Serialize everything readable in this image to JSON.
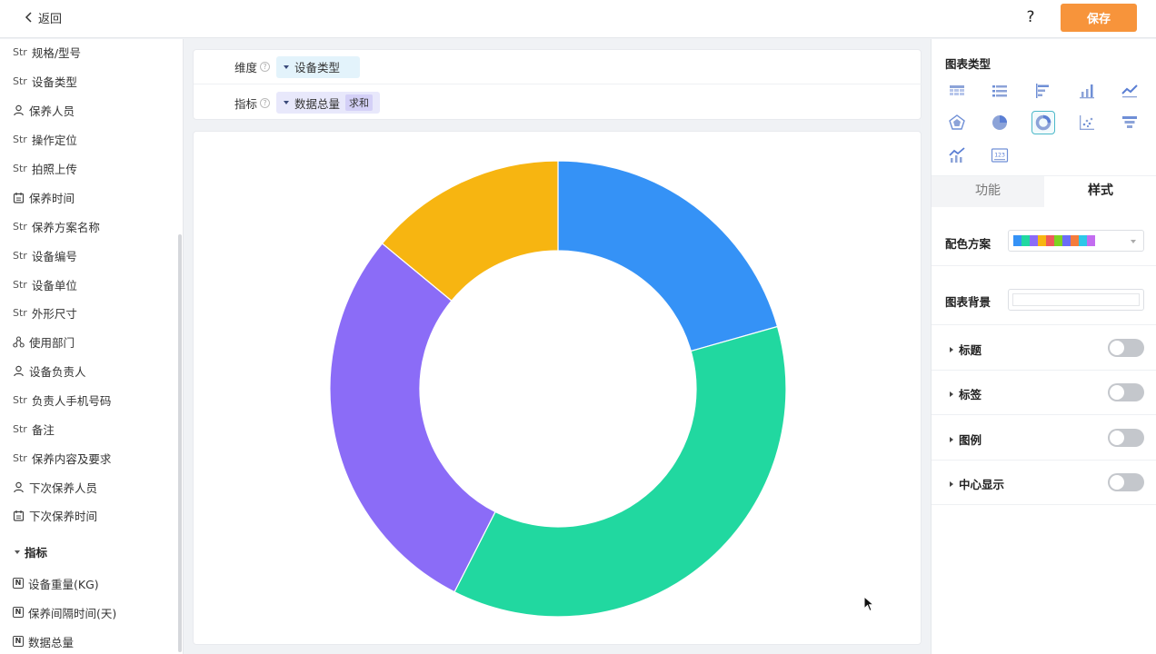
{
  "topbar": {
    "back_label": "返回",
    "help_label": "?",
    "save_label": "保存"
  },
  "fields": {
    "dimensions": [
      {
        "type": "Str",
        "label": "规格/型号"
      },
      {
        "type": "Str",
        "label": "设备类型"
      },
      {
        "type": "person-icon",
        "label": "保养人员"
      },
      {
        "type": "Str",
        "label": "操作定位"
      },
      {
        "type": "Str",
        "label": "拍照上传"
      },
      {
        "type": "calendar-icon",
        "label": "保养时间"
      },
      {
        "type": "Str",
        "label": "保养方案名称"
      },
      {
        "type": "Str",
        "label": "设备编号"
      },
      {
        "type": "Str",
        "label": "设备单位"
      },
      {
        "type": "Str",
        "label": "外形尺寸"
      },
      {
        "type": "org-icon",
        "label": "使用部门"
      },
      {
        "type": "person-icon",
        "label": "设备负责人"
      },
      {
        "type": "Str",
        "label": "负责人手机号码"
      },
      {
        "type": "Str",
        "label": "备注"
      },
      {
        "type": "Str",
        "label": "保养内容及要求"
      },
      {
        "type": "person-icon",
        "label": "下次保养人员"
      },
      {
        "type": "calendar-icon",
        "label": "下次保养时间"
      }
    ],
    "metrics_section": "指标",
    "metric_badge": "N",
    "metrics": [
      {
        "label": "设备重量(KG)"
      },
      {
        "label": "保养间隔时间(天)"
      },
      {
        "label": "数据总量"
      }
    ]
  },
  "config": {
    "dimension_label": "维度",
    "dimension_value": "设备类型",
    "metric_label": "指标",
    "metric_value": "数据总量",
    "metric_agg": "求和",
    "help_mark": "?"
  },
  "chart_data": {
    "type": "pie",
    "donut": true,
    "values": [
      20.6,
      36.9,
      28.5,
      14.0
    ],
    "colors": [
      "#3592f6",
      "#21d8a0",
      "#8b6cf7",
      "#f7b511"
    ],
    "start_angle_deg": 0,
    "direction": "clockwise"
  },
  "right_panel": {
    "chart_type_title": "图表类型",
    "chart_types": [
      {
        "icon": "table-icon",
        "selected": false
      },
      {
        "icon": "list-icon",
        "selected": false
      },
      {
        "icon": "bar-horizontal-icon",
        "selected": false
      },
      {
        "icon": "bar-vertical-icon",
        "selected": false
      },
      {
        "icon": "line-chart-icon",
        "selected": false
      },
      {
        "icon": "radar-icon",
        "selected": false
      },
      {
        "icon": "pie-icon",
        "selected": false
      },
      {
        "icon": "donut-icon",
        "selected": true
      },
      {
        "icon": "scatter-icon",
        "selected": false
      },
      {
        "icon": "funnel-icon",
        "selected": false
      },
      {
        "icon": "combo-chart-icon",
        "selected": false
      },
      {
        "icon": "number-card-icon",
        "selected": false
      }
    ],
    "number_card_text": "123",
    "tabs": [
      "功能",
      "样式"
    ],
    "active_tab": "样式",
    "color_scheme_label": "配色方案",
    "color_scheme": [
      "#3592f6",
      "#21d8a0",
      "#8b6cf7",
      "#f7b511",
      "#ef5a5a",
      "#7ed321",
      "#6b6cf7",
      "#f57c3c",
      "#2ec7e8",
      "#c36cf0"
    ],
    "background_label": "图表背景",
    "toggles": [
      {
        "label": "标题",
        "on": false
      },
      {
        "label": "标签",
        "on": false
      },
      {
        "label": "图例",
        "on": false
      },
      {
        "label": "中心显示",
        "on": false
      }
    ]
  }
}
